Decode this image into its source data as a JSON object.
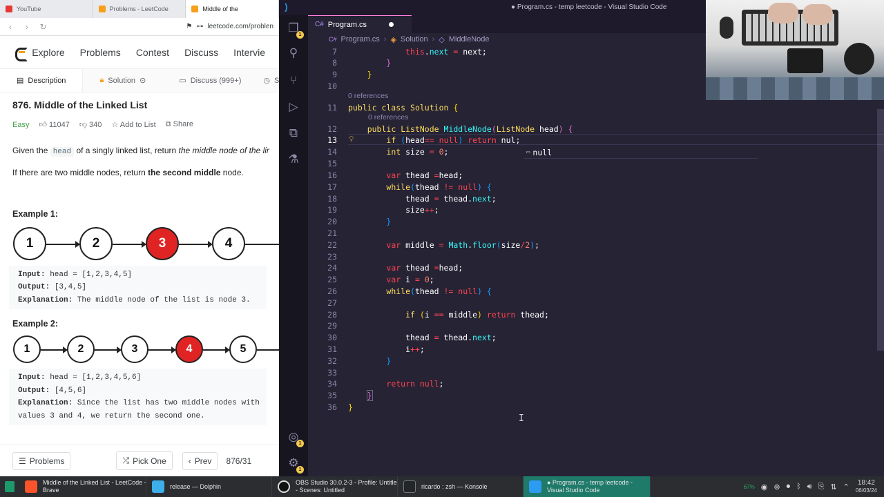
{
  "browser": {
    "tabs": [
      {
        "label": "YouTube",
        "color": "#e53935"
      },
      {
        "label": "Problems - LeetCode",
        "color": "#f89f1b"
      },
      {
        "label": "Middle of the",
        "color": "#f89f1b"
      }
    ],
    "url": "leetcode.com/problen"
  },
  "leetcode": {
    "nav": [
      "Explore",
      "Problems",
      "Contest",
      "Discuss",
      "Intervie"
    ],
    "tabs": [
      "Description",
      "Solution",
      "Discuss (999+)",
      "S"
    ],
    "title": "876. Middle of the Linked List",
    "difficulty": "Easy",
    "likes": "11047",
    "dislikes": "340",
    "add_to_list": "Add to List",
    "share": "Share",
    "desc1_a": "Given the ",
    "desc1_code": "head",
    "desc1_b": " of a singly linked list, return ",
    "desc1_c": "the middle node of the lir",
    "desc2_a": "If there are two middle nodes, return ",
    "desc2_b": "the second middle",
    "desc2_c": " node.",
    "example1": {
      "heading": "Example 1:",
      "nodes": [
        "1",
        "2",
        "3",
        "4"
      ],
      "input_label": "Input:",
      "input": " head = [1,2,3,4,5]",
      "output_label": "Output:",
      "output": " [3,4,5]",
      "expl_label": "Explanation:",
      "expl": " The middle node of the list is node 3."
    },
    "example2": {
      "heading": "Example 2:",
      "nodes": [
        "1",
        "2",
        "3",
        "4",
        "5"
      ],
      "input_label": "Input:",
      "input": " head = [1,2,3,4,5,6]",
      "output_label": "Output:",
      "output": " [4,5,6]",
      "expl_label": "Explanation:",
      "expl": " Since the list has two middle nodes with",
      "expl2": "values 3 and 4, we return the second one."
    },
    "footer": {
      "problems": "Problems",
      "pick_one": "Pick One",
      "prev": "Prev",
      "page": "876/31"
    }
  },
  "vscode": {
    "window_title": "● Program.cs - temp leetcode - Visual Studio Code",
    "tab_label": "Program.cs",
    "breadcrumbs": [
      "Program.cs",
      "Solution",
      "MiddleNode"
    ],
    "badge_count": "1",
    "references": "0 references",
    "suggestion": "null"
  },
  "taskbar": {
    "tasks": [
      {
        "label": "Middle of the Linked List - LeetCode -",
        "label2": "Brave",
        "color": "#fb542b"
      },
      {
        "label": "release — Dolphin",
        "label2": "",
        "color": "#3daee9"
      },
      {
        "label": "OBS Studio 30.0.2-3 - Profile: Untitled",
        "label2": "- Scenes: Untitled",
        "color": "#302e31"
      },
      {
        "label": "ricardo : zsh — Konsole",
        "label2": "",
        "color": "#232629"
      },
      {
        "label": "● Program.cs - temp leetcode -",
        "label2": "Visual Studio Code",
        "color": "#2d9cf0"
      }
    ],
    "battery": "67%",
    "time": "18:42",
    "date": "06/03/24"
  }
}
